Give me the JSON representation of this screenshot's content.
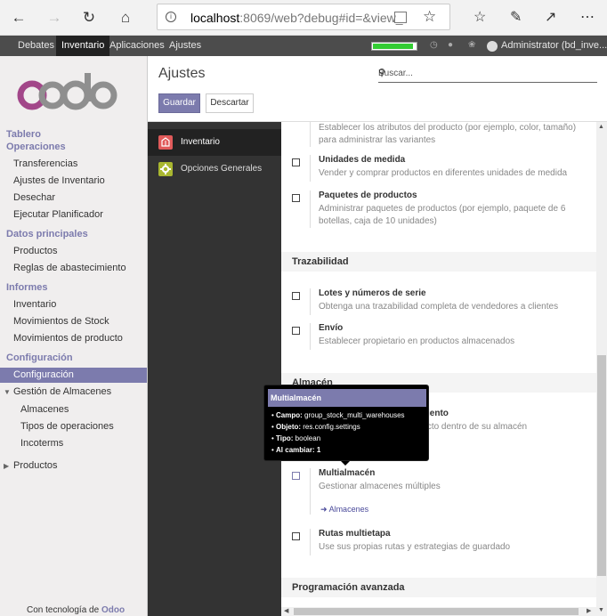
{
  "browser": {
    "url_host": "localhost",
    "url_rest": ":8069/web?debug#id=&view_"
  },
  "topbar": {
    "menus": [
      "Debates",
      "Inventario",
      "Aplicaciones",
      "Ajustes"
    ],
    "active_menu": "Inventario",
    "progress": 0.9,
    "user": "Administrator (bd_inve..."
  },
  "sidebar": {
    "logo_text": "odoo",
    "sections": {
      "tablero": "Tablero",
      "operaciones": "Operaciones",
      "datos": "Datos principales",
      "informes": "Informes",
      "configuracion": "Configuración"
    },
    "operaciones_items": [
      "Transferencias",
      "Ajustes de Inventario",
      "Desechar",
      "Ejecutar Planificador"
    ],
    "datos_items": [
      "Productos",
      "Reglas de abastecimiento"
    ],
    "informes_items": [
      "Inventario",
      "Movimientos de Stock",
      "Movimientos de producto"
    ],
    "config_active": "Configuración",
    "almacenes_group": "Gestión de Almacenes",
    "almacenes_items": [
      "Almacenes",
      "Tipos de operaciones",
      "Incoterms"
    ],
    "productos_group": "Productos",
    "powered_prefix": "Con tecnología de",
    "powered_brand": "Odoo"
  },
  "control_panel": {
    "title": "Ajustes",
    "save_label": "Guardar",
    "discard_label": "Descartar",
    "search_placeholder": "Buscar..."
  },
  "settings_nav": [
    "Inventario",
    "Opciones Generales"
  ],
  "content": {
    "variants_desc": "Establecer los atributos del producto (por ejemplo, color, tamaño) para administrar las variantes",
    "uom_title": "Unidades de medida",
    "uom_desc": "Vender y comprar productos en diferentes unidades de medida",
    "packages_title": "Paquetes de productos",
    "packages_desc": "Administrar paquetes de productos (por ejemplo, paquete de 6 botellas, caja de 10 unidades)",
    "traceability": "Trazabilidad",
    "lots_title": "Lotes y números de serie",
    "lots_desc": "Obtenga una trazabilidad completa de vendedores a clientes",
    "consign_title": "Envío",
    "consign_desc": "Establecer propietario en productos almacenados",
    "warehouse": "Almacén",
    "location_title_tail": "iento",
    "location_desc_tail": "a de producto dentro de su almacén",
    "multiwh_title": "Multialmacén",
    "multiwh_desc": "Gestionar almacenes múltiples",
    "multiwh_link": "Almacenes",
    "multistep_title": "Rutas multietapa",
    "multistep_desc": "Use sus propias rutas y estrategias de guardado",
    "advanced": "Programación avanzada"
  },
  "tooltip": {
    "title": "Multialmacén",
    "field_label": "Campo:",
    "field_value": "group_stock_multi_warehouses",
    "object_label": "Objeto:",
    "object_value": "res.config.settings",
    "type_label": "Tipo:",
    "type_value": "boolean",
    "onchange_label": "Al cambiar:",
    "onchange_value": "1"
  },
  "colors": {
    "brand": "#7c7bad",
    "topbar": "#4c4c4c",
    "settings_nav": "#333333"
  }
}
